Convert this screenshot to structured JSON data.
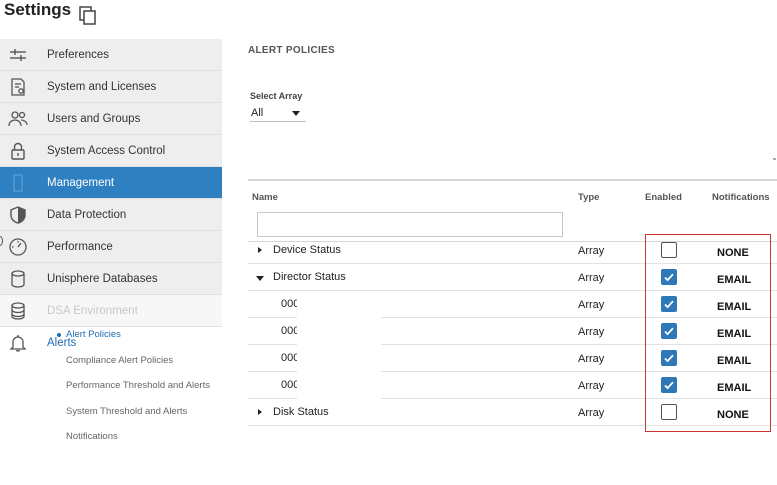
{
  "header": {
    "title": "Settings",
    "copy_icon": "copy-window-icon"
  },
  "sidebar": {
    "items": [
      {
        "label": "Preferences",
        "icon": "sliders-icon"
      },
      {
        "label": "System and Licenses",
        "icon": "license-document-icon"
      },
      {
        "label": "Users and Groups",
        "icon": "users-icon"
      },
      {
        "label": "System Access Control",
        "icon": "lock-icon"
      },
      {
        "label": "Management",
        "icon": "server-icon",
        "active": true
      },
      {
        "label": "Data Protection",
        "icon": "shield-icon"
      },
      {
        "label": "Performance",
        "icon": "gauge-icon"
      },
      {
        "label": "Unisphere Databases",
        "icon": "database-icon"
      },
      {
        "label": "DSA Environment",
        "icon": "database-stack-icon",
        "disabled": true
      },
      {
        "label": "Alerts",
        "icon": "bell-icon",
        "expanded": true
      }
    ],
    "alerts_subitems": [
      {
        "label": "Alert Policies",
        "active": true
      },
      {
        "label": "Compliance Alert Policies"
      },
      {
        "label": "Performance Threshold and Alerts"
      },
      {
        "label": "System Threshold and Alerts"
      },
      {
        "label": "Notifications"
      }
    ]
  },
  "main": {
    "section_title": "ALERT POLICIES",
    "select_array": {
      "label": "Select Array",
      "value": "All"
    },
    "table": {
      "columns": [
        "Name",
        "Type",
        "Enabled",
        "Notifications"
      ],
      "filter_value": "",
      "rows": [
        {
          "name": "Device Status",
          "type": "Array",
          "enabled": false,
          "notifications": "NONE",
          "expander": "collapsed",
          "child": false
        },
        {
          "name": "Director Status",
          "type": "Array",
          "enabled": true,
          "notifications": "EMAIL",
          "expander": "expanded",
          "child": false
        },
        {
          "name": "000",
          "type": "Array",
          "enabled": true,
          "notifications": "EMAIL",
          "child": true
        },
        {
          "name": "000",
          "type": "Array",
          "enabled": true,
          "notifications": "EMAIL",
          "child": true
        },
        {
          "name": "000",
          "type": "Array",
          "enabled": true,
          "notifications": "EMAIL",
          "child": true
        },
        {
          "name": "000",
          "type": "Array",
          "enabled": true,
          "notifications": "EMAIL",
          "child": true
        },
        {
          "name": "Disk Status",
          "type": "Array",
          "enabled": false,
          "notifications": "NONE",
          "expander": "collapsed",
          "child": false
        }
      ]
    }
  },
  "colors": {
    "accent": "#2f80c0",
    "checkbox": "#2f78b8",
    "highlight": "#cc3333",
    "link": "#1f6db3"
  }
}
